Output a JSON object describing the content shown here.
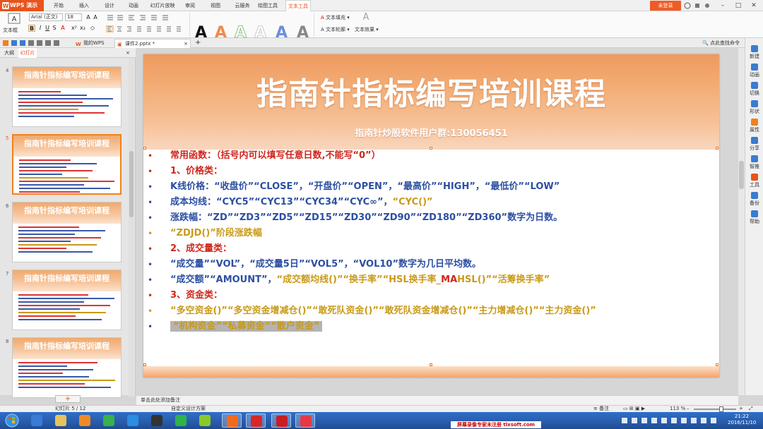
{
  "titlebar": {
    "app_name": "WPS 演示",
    "menu_tabs": [
      "开始",
      "插入",
      "设计",
      "动画",
      "幻灯片放映",
      "审阅",
      "视图",
      "云服务",
      "绘图工具",
      "文本工具"
    ],
    "login": "未登录"
  },
  "ribbon": {
    "textbox_label": "文本框",
    "font_name": "Arial (正文)",
    "font_size": "18",
    "text_fill": "文本填充",
    "text_outline": "文本轮廓",
    "text_effect": "文本效果",
    "art_letters": [
      "A",
      "A",
      "A",
      "A",
      "A",
      "A"
    ]
  },
  "tabbar": {
    "tabs": [
      "我的WPS",
      "课件2.pptx *"
    ],
    "search": "点此查找命令"
  },
  "left_panel": {
    "tabs": [
      "大纲",
      "幻灯片"
    ],
    "slide_numbers": [
      "4",
      "5",
      "6",
      "7",
      "8"
    ],
    "thumb_title": "指南针指标编写培训课程"
  },
  "slide": {
    "title": "指南针指标编写培训课程",
    "subtitle": "指南针炒股软件用户群:130056451",
    "lines": [
      {
        "color": "red",
        "segments": [
          {
            "t": "常用函数：（括号内可以填写任意日数,不能写“0”）",
            "c": "red"
          }
        ]
      },
      {
        "color": "red",
        "segments": [
          {
            "t": "1、价格类：",
            "c": "red"
          }
        ]
      },
      {
        "color": "blue",
        "segments": [
          {
            "t": "K线价格：“收盘价”“CLOSE”，“开盘价”“OPEN”，“最高价”“HIGH”，“最低价”“LOW”",
            "c": "blue"
          }
        ]
      },
      {
        "color": "blue",
        "segments": [
          {
            "t": "成本均线：“CYC5”“CYC13”“CYC34”“CYC∞”，",
            "c": "blue"
          },
          {
            "t": "“CYC()”",
            "c": "gold"
          }
        ]
      },
      {
        "color": "blue",
        "segments": [
          {
            "t": "涨跌幅：“ZD”“ZD3”“ZD5”“ZD15”“ZD30”“ZD90”“ZD180”“ZD360”数字为日数。",
            "c": "blue"
          }
        ]
      },
      {
        "color": "gold",
        "segments": [
          {
            "t": "“ZDJD()”阶段涨跌幅",
            "c": "gold"
          }
        ]
      },
      {
        "color": "red",
        "segments": [
          {
            "t": "2、成交量类：",
            "c": "red"
          }
        ]
      },
      {
        "color": "blue",
        "segments": [
          {
            "t": "“成交量”“VOL”，“成交量5日”“VOL5”，“VOL10”数字为几日平均数。",
            "c": "blue"
          }
        ]
      },
      {
        "color": "blue",
        "segments": [
          {
            "t": "“成交额”“AMOUNT”，",
            "c": "blue"
          },
          {
            "t": "“成交额均线()”“换手率”“HSL换手率_",
            "c": "gold"
          },
          {
            "t": "MA",
            "c": "red"
          },
          {
            "t": "HSL()”“活筹换手率”",
            "c": "gold"
          }
        ]
      },
      {
        "color": "red",
        "segments": [
          {
            "t": "3、资金类：",
            "c": "red"
          }
        ]
      },
      {
        "color": "gold",
        "segments": [
          {
            "t": "“多空资金()”“多空资金增减仓()”“敢死队资金()”“敢死队资金增减仓()”“主力增减仓()”“主力资金()”",
            "c": "gold"
          }
        ]
      },
      {
        "color": "blue",
        "segments": [
          {
            "t": "“机构资金”“私募资金”“散户资金”",
            "c": "gold",
            "hl": true
          }
        ]
      }
    ]
  },
  "right_sidebar": [
    "新建",
    "动画",
    "切换",
    "形状",
    "属性",
    "分享",
    "智推",
    "工具",
    "备份",
    "帮助"
  ],
  "notes": "单击此处添加备注",
  "status": {
    "slide_pos": "幻灯片 5 / 12",
    "design": "自定义设计方案",
    "notes_btn": "备注",
    "zoom": "113 %"
  },
  "taskbar": {
    "watermark": "屏幕录像专家未注册 tlxsoft.com",
    "time": "21:22",
    "date": "2016/11/10"
  }
}
